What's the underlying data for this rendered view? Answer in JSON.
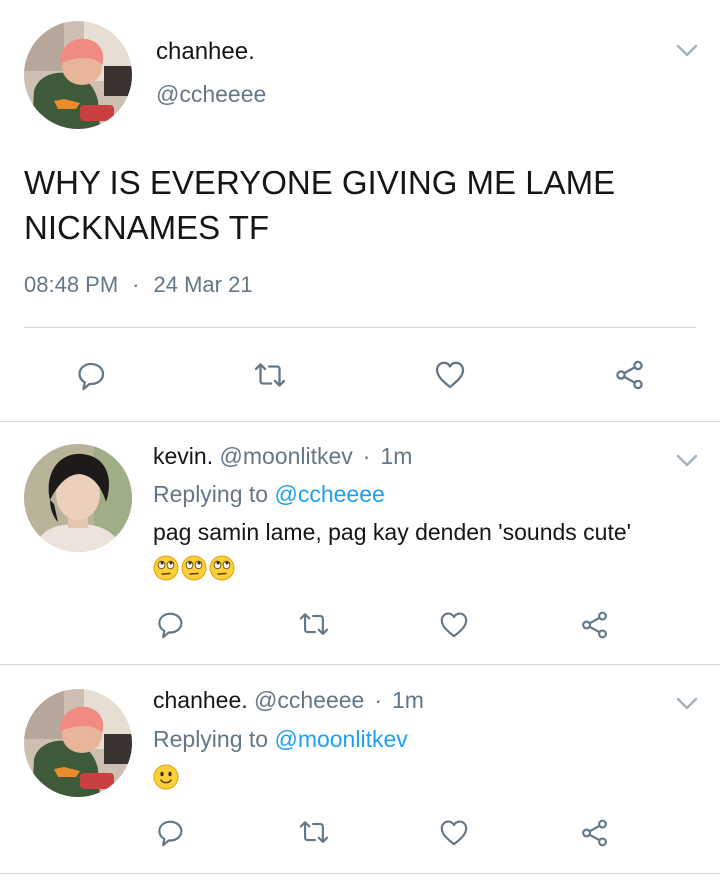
{
  "main_tweet": {
    "name": "chanhee.",
    "handle": "@ccheeee",
    "text": "WHY IS EVERYONE GIVING ME LAME NICKNAMES TF",
    "time": "08:48 PM",
    "separator": "·",
    "date": "24 Mar 21"
  },
  "replies": [
    {
      "name": "kevin.",
      "handle": "@moonlitkev",
      "separator": "·",
      "time": "1m",
      "replying_prefix": "Replying to",
      "replying_to": "@ccheeee",
      "text": "pag samin lame, pag kay denden 'sounds cute'",
      "emojis": [
        "rolling-eyes",
        "rolling-eyes",
        "rolling-eyes"
      ]
    },
    {
      "name": "chanhee.",
      "handle": "@ccheeee",
      "separator": "·",
      "time": "1m",
      "replying_prefix": "Replying to",
      "replying_to": "@moonlitkev",
      "emojis": [
        "slightly-smiling"
      ]
    }
  ],
  "icons": [
    "reply-icon",
    "retweet-icon",
    "like-icon",
    "share-icon",
    "chevron-down-icon"
  ],
  "colors": {
    "text": "#14171a",
    "secondary": "#657786",
    "link": "#1da1f2",
    "border": "#cfd9de"
  }
}
